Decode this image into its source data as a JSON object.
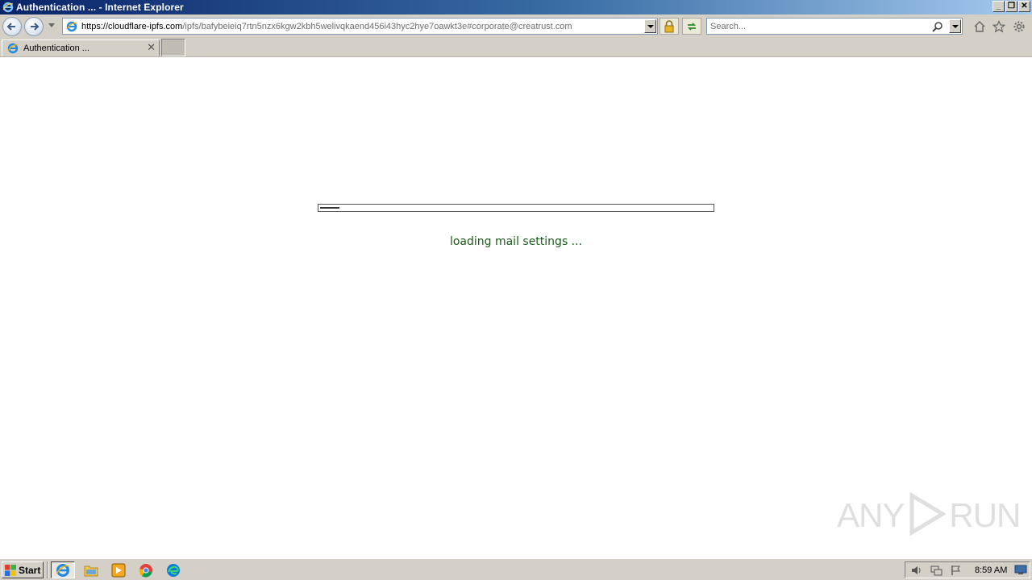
{
  "window": {
    "title": "Authentication ... - Internet Explorer",
    "controls": {
      "minimize": "_",
      "restore": "❐",
      "close": "✕"
    }
  },
  "navbar": {
    "back_icon": "back-arrow-icon",
    "forward_icon": "forward-arrow-icon",
    "url_host": "https://cloudflare-ipfs.com",
    "url_path": "/ipfs/bafybeieiq7rtn5nzx6kgw2kbh5welivqkaend456i43hyc2hye7oawkt3e#corporate@creatrust.com",
    "search_placeholder": "Search..."
  },
  "tabs": [
    {
      "label": "Authentication ...",
      "close": "✕"
    }
  ],
  "page": {
    "loading_text": "loading mail settings ...",
    "progress_fraction": 0.05
  },
  "watermark": {
    "left": "ANY",
    "right": "RUN"
  },
  "taskbar": {
    "start_label": "Start",
    "clock": "8:59 AM",
    "apps": [
      "internet-explorer-icon",
      "file-explorer-icon",
      "media-player-icon",
      "chrome-icon",
      "edge-icon"
    ]
  }
}
